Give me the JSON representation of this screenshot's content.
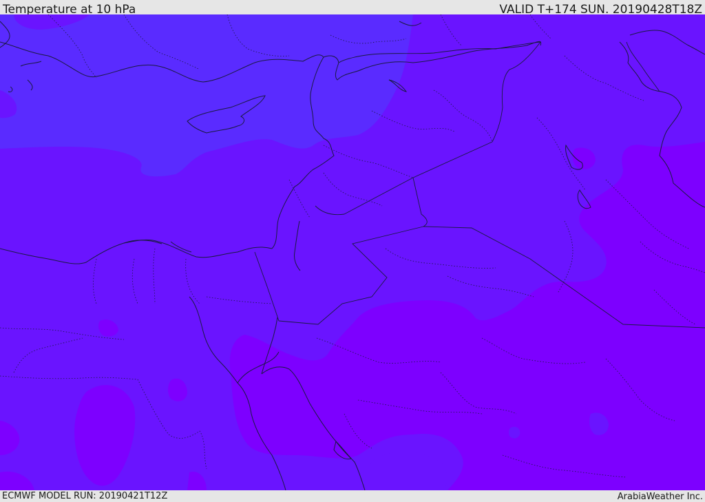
{
  "header": {
    "title": "Temperature at 10 hPa",
    "valid_time": "VALID T+174 SUN. 20190428T18Z"
  },
  "footer": {
    "model_run": "ECMWF MODEL RUN: 20190421T12Z",
    "credit": "ArabiaWeather Inc."
  },
  "map": {
    "region": "Eastern Mediterranean & Middle East",
    "field_colors": {
      "cool_zone": "#5a2bff",
      "mid_zone": "#6a14ff",
      "warm_zone": "#7d00ff"
    },
    "coastline_color": "#1a1a40",
    "border_style": "dotted"
  }
}
